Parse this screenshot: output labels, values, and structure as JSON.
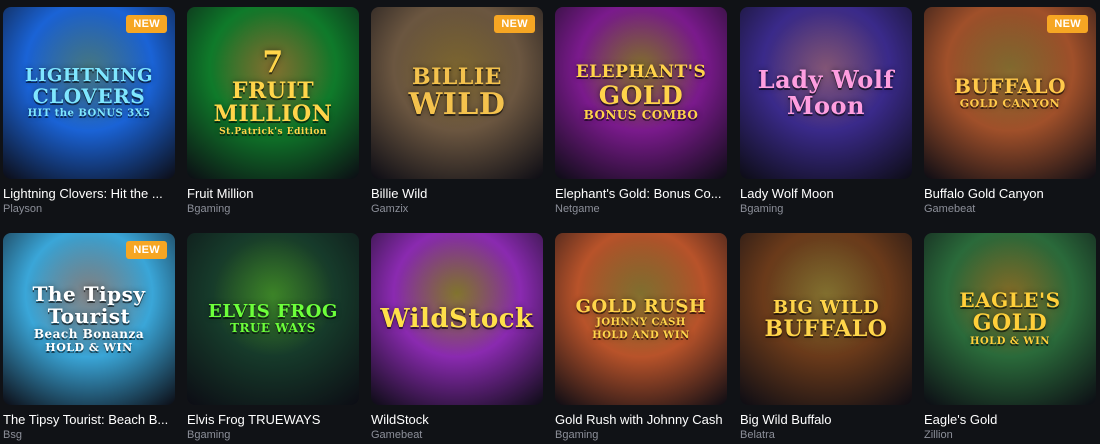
{
  "badges": {
    "new": "NEW"
  },
  "games": [
    {
      "title": "Lightning Clovers: Hit the ...",
      "provider": "Playson",
      "logo_lines": [
        "LIGHTNING",
        "CLOVERS",
        "HIT the BONUS 3X5"
      ],
      "is_new": true,
      "bg": "#1a63d6",
      "accent": "#7fe7ff"
    },
    {
      "title": "Fruit Million",
      "provider": "Bgaming",
      "logo_lines": [
        "7",
        "FRUIT",
        "MILLION",
        "St.Patrick's Edition"
      ],
      "is_new": false,
      "bg": "#0f7a2a",
      "accent": "#ffd54a"
    },
    {
      "title": "Billie Wild",
      "provider": "Gamzix",
      "logo_lines": [
        "BILLIE",
        "WILD"
      ],
      "is_new": true,
      "bg": "#6b5640",
      "accent": "#f4c24d"
    },
    {
      "title": "Elephant's Gold: Bonus Co...",
      "provider": "Netgame",
      "logo_lines": [
        "ELEPHANT'S",
        "GOLD",
        "BONUS COMBO"
      ],
      "is_new": false,
      "bg": "#7a1a8c",
      "accent": "#ffd34a"
    },
    {
      "title": "Lady Wolf Moon",
      "provider": "Bgaming",
      "logo_lines": [
        "Lady Wolf",
        "Moon"
      ],
      "is_new": false,
      "bg": "#3a2a8a",
      "accent": "#ff9ee0"
    },
    {
      "title": "Buffalo Gold Canyon",
      "provider": "Gamebeat",
      "logo_lines": [
        "BUFFALO",
        "GOLD CANYON"
      ],
      "is_new": true,
      "bg": "#a0502a",
      "accent": "#ffc94a"
    },
    {
      "title": "The Tipsy Tourist: Beach B...",
      "provider": "Bsg",
      "logo_lines": [
        "The Tipsy",
        "Tourist",
        "Beach Bonanza",
        "HOLD & WIN"
      ],
      "is_new": true,
      "bg": "#3aa6d8",
      "accent": "#ffffff"
    },
    {
      "title": "Elvis Frog TRUEWAYS",
      "provider": "Bgaming",
      "logo_lines": [
        "ELVIS FROG",
        "TRUE WAYS"
      ],
      "is_new": false,
      "bg": "#163a2a",
      "accent": "#6cff3a"
    },
    {
      "title": "WildStock",
      "provider": "Gamebeat",
      "logo_lines": [
        "WildStock"
      ],
      "is_new": false,
      "bg": "#8a2ab0",
      "accent": "#ffe04a"
    },
    {
      "title": "Gold Rush with Johnny Cash",
      "provider": "Bgaming",
      "logo_lines": [
        "GOLD RUSH",
        "JOHNNY CASH",
        "HOLD AND WIN"
      ],
      "is_new": false,
      "bg": "#b8532a",
      "accent": "#ffd54a"
    },
    {
      "title": "Big Wild Buffalo",
      "provider": "Belatra",
      "logo_lines": [
        "BIG WILD",
        "BUFFALO"
      ],
      "is_new": false,
      "bg": "#6a3a1a",
      "accent": "#ffd54a"
    },
    {
      "title": "Eagle's Gold",
      "provider": "Zillion",
      "logo_lines": [
        "EAGLE'S",
        "GOLD",
        "HOLD & WIN"
      ],
      "is_new": false,
      "bg": "#2a6a3a",
      "accent": "#ffcf3a"
    }
  ]
}
